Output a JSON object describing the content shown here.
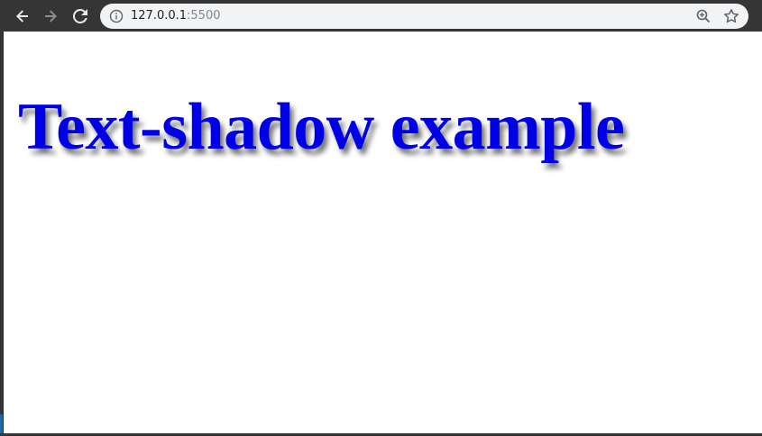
{
  "browser": {
    "url_host": "127.0.0.1",
    "url_port": ":5500",
    "icons": {
      "back": "back-arrow-icon",
      "forward": "forward-arrow-icon",
      "reload": "reload-icon",
      "info": "info-icon",
      "zoom": "zoom-icon",
      "bookmark": "star-icon"
    }
  },
  "page": {
    "heading": "Text-shadow example",
    "heading_color": "#0000e6"
  }
}
